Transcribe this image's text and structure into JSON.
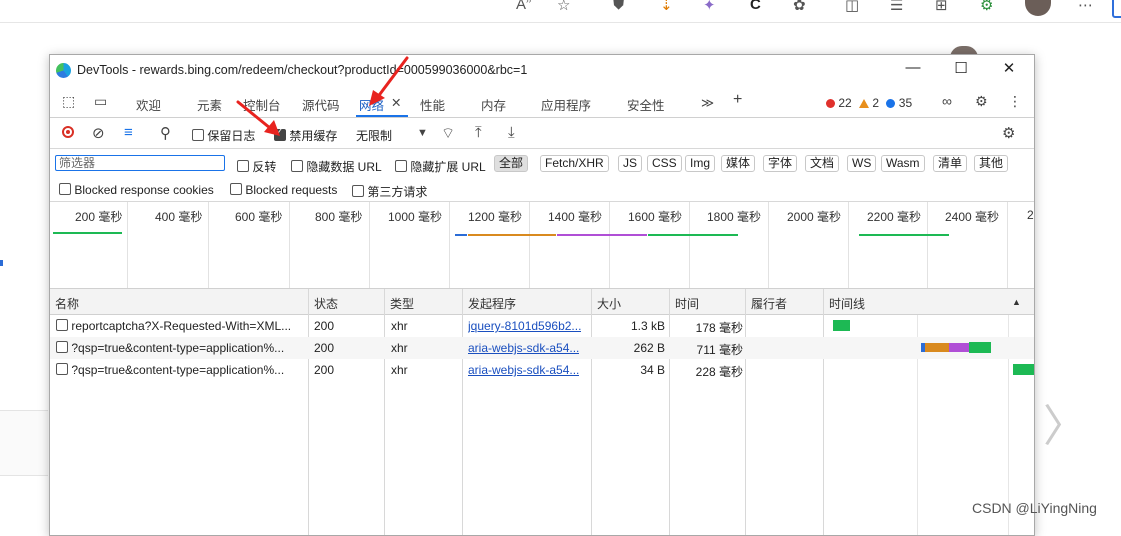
{
  "window_title": "DevTools - rewards.bing.com/redeem/checkout?productId=000599036000&rbc=1",
  "window_controls": {
    "minimize": "—",
    "maximize": "☐",
    "close": "✕"
  },
  "tabs": [
    {
      "label": "欢迎"
    },
    {
      "label": "元素"
    },
    {
      "label": "控制台"
    },
    {
      "label": "源代码"
    },
    {
      "label": "网络"
    },
    {
      "label": "性能"
    },
    {
      "label": "内存"
    },
    {
      "label": "应用程序"
    },
    {
      "label": "安全性"
    }
  ],
  "more_tabs": "≫",
  "add_tab": "+",
  "tab_close": "✕",
  "issue_counts": {
    "errors": "22",
    "warnings": "2",
    "info": "35"
  },
  "toolbar": {
    "preserve_log": "保留日志",
    "disable_cache": "禁用缓存",
    "throttling": "无限制",
    "disable_cache_checked": true
  },
  "filter": {
    "placeholder": "筛选器",
    "invert": "反转",
    "hide_data_url": "隐藏数据 URL",
    "hide_ext_url": "隐藏扩展 URL",
    "types": [
      "全部",
      "Fetch/XHR",
      "JS",
      "CSS",
      "Img",
      "媒体",
      "字体",
      "文档",
      "WS",
      "Wasm",
      "清单",
      "其他"
    ],
    "selected_type": "全部"
  },
  "filter_row2": {
    "blocked_cookies": "Blocked response cookies",
    "blocked_requests": "Blocked requests",
    "third_party": "第三方请求"
  },
  "overview_ticks": [
    "200 毫秒",
    "400 毫秒",
    "600 毫秒",
    "800 毫秒",
    "1000 毫秒",
    "1200 毫秒",
    "1400 毫秒",
    "1600 毫秒",
    "1800 毫秒",
    "2000 毫秒",
    "2200 毫秒",
    "2400 毫秒",
    "2"
  ],
  "columns": [
    "名称",
    "状态",
    "类型",
    "发起程序",
    "大小",
    "时间",
    "履行者",
    "时间线"
  ],
  "sort_indicator": "▲",
  "requests": [
    {
      "name": "reportcaptcha?X-Requested-With=XML...",
      "status": "200",
      "type": "xhr",
      "initiator": "jquery-8101d596b2...",
      "size": "1.3 kB",
      "time": "178 毫秒"
    },
    {
      "name": "?qsp=true&content-type=application%...",
      "status": "200",
      "type": "xhr",
      "initiator": "aria-webjs-sdk-a54...",
      "size": "262 B",
      "time": "711 毫秒"
    },
    {
      "name": "?qsp=true&content-type=application%...",
      "status": "200",
      "type": "xhr",
      "initiator": "aria-webjs-sdk-a54...",
      "size": "34 B",
      "time": "228 毫秒"
    }
  ],
  "colors": {
    "accent": "#1a73e8",
    "error": "#e0312c",
    "warning": "#e88f1c",
    "waterfall_green": "#1db954",
    "waterfall_orange": "#d98a1f",
    "waterfall_purple": "#b04fd6",
    "annotation_arrow": "#e8231f"
  },
  "watermark": "CSDN @LiYingNing",
  "background_chevron": "〉"
}
